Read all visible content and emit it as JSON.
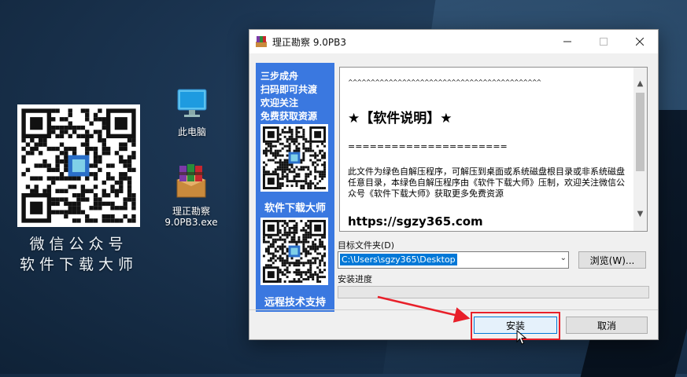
{
  "desktop": {
    "caption_line1": "微信公众号",
    "caption_line2": "软件下载大师",
    "icons": [
      {
        "label": "此电脑",
        "icon": "monitor-icon"
      },
      {
        "label": "理正勘察\n9.0PB3.exe",
        "icon": "winrar-archive-icon"
      }
    ]
  },
  "dialog": {
    "title": "理正勘察 9.0PB3",
    "left_panel": {
      "promo_lines": [
        "三步成舟",
        "扫码即可共渡",
        "欢迎关注",
        "免费获取资源"
      ],
      "mid_label": "软件下载大师",
      "bottom_label": "远程技术支持"
    },
    "textbox": {
      "line_carets": "^^^^^^^^^^^^^^^^^^^^^^^^^^^^^^^^^^^^^^^^^^^",
      "heading": "★【软件说明】★",
      "line_equals": "======================",
      "description": "此文件为绿色自解压程序，可解压到桌面或系统磁盘根目录或非系统磁盘任意目录，本绿色自解压程序由《软件下载大师》压制，欢迎关注微信公众号《软件下载大师》获取更多免费资源",
      "url": "https://sgzy365.com"
    },
    "target_folder_label": "目标文件夹(D)",
    "target_folder_value": "C:\\Users\\sgzy365\\Desktop",
    "browse_label": "浏览(W)...",
    "progress_label": "安装进度",
    "progress_value": 0,
    "install_label": "安装",
    "cancel_label": "取消"
  },
  "colors": {
    "accent_blue": "#3a78e0",
    "highlight_red": "#e8202a"
  }
}
